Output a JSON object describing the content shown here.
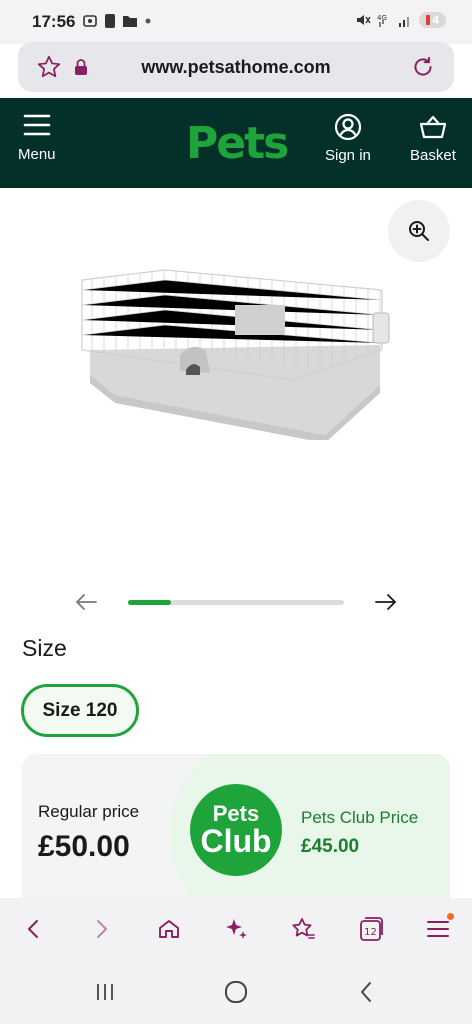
{
  "status_bar": {
    "time": "17:56",
    "battery": "4"
  },
  "browser": {
    "url": "www.petsathome.com"
  },
  "header": {
    "logo": "Pets",
    "menu_label": "Menu",
    "signin_label": "Sign in",
    "basket_label": "Basket"
  },
  "carousel": {
    "progress": 0.2
  },
  "size": {
    "label": "Size",
    "selected": "Size 120"
  },
  "pricing": {
    "regular_label": "Regular price",
    "regular_price": "£50.00",
    "club_badge_top": "Pets",
    "club_badge_bottom": "Club",
    "club_label": "Pets Club Price",
    "club_price": "£45.00"
  },
  "browser_nav": {
    "tab_count": "12"
  },
  "colors": {
    "brand_green": "#1ea43a",
    "header_bg": "#04302a",
    "nav_purple": "#8a1f63"
  }
}
